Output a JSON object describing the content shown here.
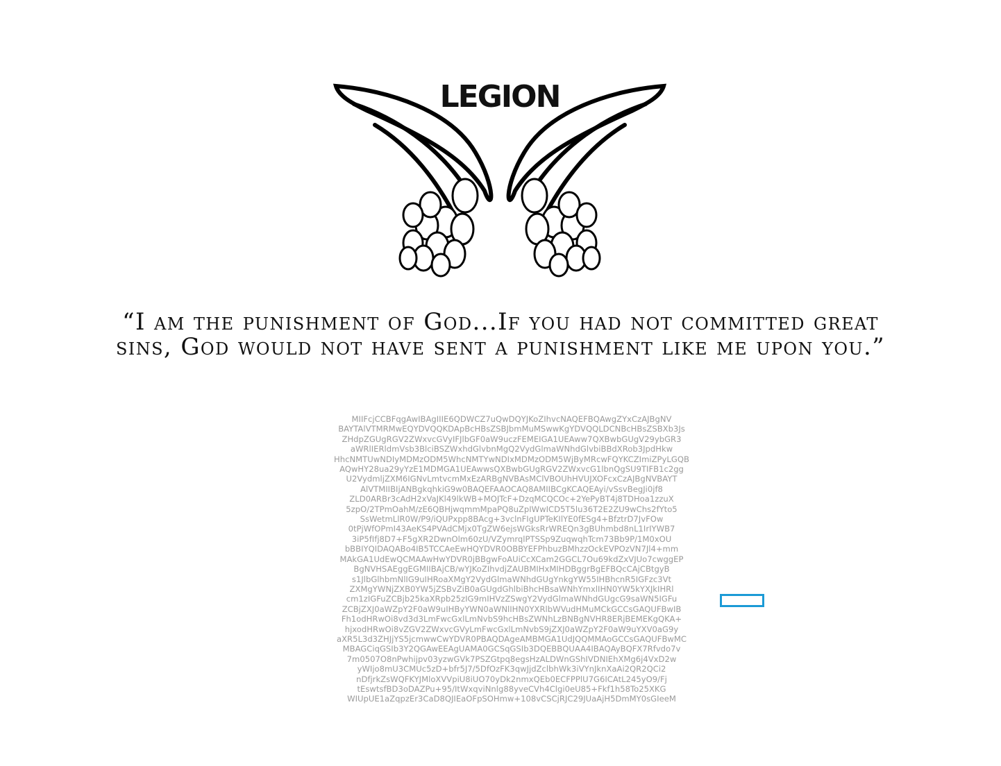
{
  "logo": {
    "text": "LEGION",
    "icon": "angel-wings-icon"
  },
  "quote": {
    "line1": "“I am the punishment of God...If you had not committed great",
    "line2": "sins, God would not have sent a punishment like me upon you.”"
  },
  "certificate_lines": [
    "MIIFcjCCBFqgAwIBAgIIIE6QDWCZ7uQwDQYJKoZIhvcNAQEFBQAwgZYxCzAJBgNV",
    "BAYTAlVTMRMwEQYDVQQKDApBcHBsZSBJbmMuMSwwKgYDVQQLDCNBcHBsZSBXb3Js",
    "ZHdpZGUgRGV2ZWxvcGVyIFJlbGF0aW9uczFEMEIGA1UEAww7QXBwbGUgV29ybGR3",
    "aWRlIERldmVsb3BlciBSZWxhdGlvbnMgQ2VydGlmaWNhdGlvbiBBdXRob3JpdHkw",
    "HhcNMTUwNDIyMDMzODM5WhcNMTYwNDIxMDMzODM5WjByMRcwFQYKCZImiZPyLGQB",
    "AQwHY28ua29yYzE1MDMGA1UEAwwsQXBwbGUgRGV2ZWxvcG1lbnQgSU9TIFB1c2gg",
    "U2VydmljZXM6IGNvLmtvcmMxEzARBgNVBAsMClVBOUhHVUJXOFcxCzAJBgNVBAYT",
    "AlVTMIIBIjANBgkqhkiG9w0BAQEFAAOCAQ8AMIIBCgKCAQEAyi/vSsvBegJi0jf8",
    "ZLD0ARBr3cAdH2xVaJKl49lkWB+MOJTcF+DzqMCQCOc+2YePyBT4j8TDHoa1zzuX",
    "5zpO/2TPmOahM/zE6QBHjwqmmMpaPQ8uZpIWwICD5T5lu36T2E2ZU9wChs2fYto5",
    "SsWetmLlR0W/P9/iQUPxpp8BAcg+3vclnFIgUPTeKIlYE0fESg4+BfztrD7JvFOw",
    "0tPjWfOPmI43AeKS4PVAdCMjx0TgZW6ejsWGksRrWREQn3gBUhmbd8nL1IrIYWB7",
    "3iP5fIfj8D7+F5gXR2DwnOlm60zU/VZymrqlPTSSp9ZuqwqhTcm73Bb9P/1M0xOU",
    "bBBIYQIDAQABo4IB5TCCAeEwHQYDVR0OBBYEFPhbuzBMhzzOckEVPOzVN7Jl4+mm",
    "MAkGA1UdEwQCMAAwHwYDVR0jBBgwFoAUiCcXCam2GGCL7Ou69kdZxVJUo7cwggEP",
    "BgNVHSAEggEGMIIBAjCB/wYJKoZIhvdjZAUBMIHxMIHDBggrBgEFBQcCAjCBtgyB",
    "s1JlbGlhbmNlIG9uIHRoaXMgY2VydGlmaWNhdGUgYnkgYW55IHBhcnR5IGFzc3Vt",
    "ZXMgYWNjZXB0YW5jZSBvZiB0aGUgdGhlbiBhcHBsaWNhYmxlIHN0YW5kYXJkIHRl",
    "cm1zIGFuZCBjb25kaXRpb25zIG9mIHVzZSwgY2VydGlmaWNhdGUgcG9saWN5IGFu",
    "ZCBjZXJ0aWZpY2F0aW9uIHByYWN0aWNlIHN0YXRlbWVudHMuMCkGCCsGAQUFBwIB",
    "Fh1odHRwOi8vd3d3LmFwcGxlLmNvbS9hcHBsZWNhLzBNBgNVHR8ERjBEMEKgQKA+",
    "hjxodHRwOi8vZGV2ZWxvcGVyLmFwcGxlLmNvbS9jZXJ0aWZpY2F0aW9uYXV0aG9y",
    "aXR5L3d3ZHJjYS5jcmwwCwYDVR0PBAQDAgeAMBMGA1UdJQQMMAoGCCsGAQUFBwMC",
    "MBAGCiqGSIb3Y2QGAwEEAgUAMA0GCSqGSIb3DQEBBQUAA4IBAQAyBQFX7Rfvdo7v",
    "7m0507O8nPwhijpv03yzwGVk7PSZGtpq8egsHzALDWnGShIVDNIEhXMg6j4VxD2w",
    "yWIjo8mU3CMUc5zD+bfr5J7/5DfOzFK3qwJjdZclbhWk3iVYnJknXaAi2QR2QCi2",
    "nDfjrkZsWQFKYJMloXVVpiU8iUO70yDk2nmxQEb0ECFPPlU7G6ICAtL245yO9/Fj",
    "tEswtsfBD3oDAZPu+95/ItWxqviNnlg88yveCVh4Clgi0eU85+Fkf1h58To25XKG",
    "WIUpUE1aZqpzEr3CaD8QJIEaOFpSOHmw+108vCSCjRJC29JUaAjH5DmMY0sGIeeM"
  ]
}
